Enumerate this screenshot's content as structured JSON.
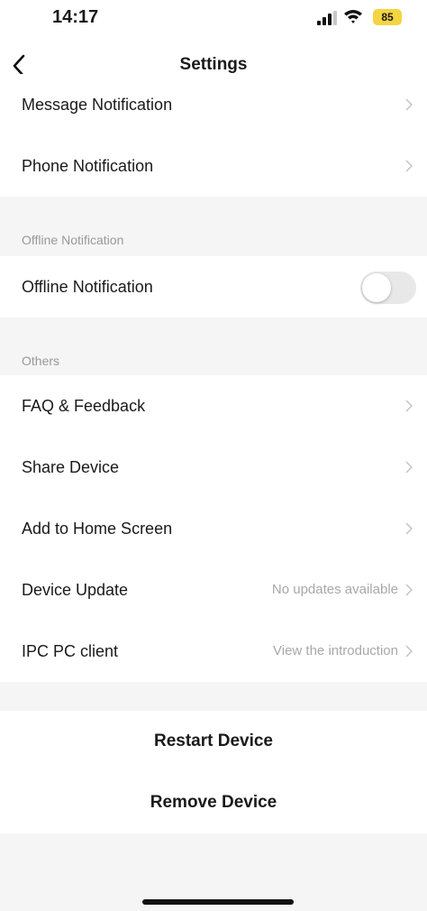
{
  "status_bar": {
    "time": "14:17",
    "battery": "85",
    "battery_color": "#f5d442"
  },
  "nav": {
    "title": "Settings",
    "back_icon": "chevron-left-icon"
  },
  "rows_top": [
    {
      "label": "Message Notification"
    },
    {
      "label": "Phone Notification"
    }
  ],
  "offline_section": {
    "header": "Offline Notification",
    "row_label": "Offline Notification",
    "toggle_on": false
  },
  "others_section": {
    "header": "Others",
    "rows": [
      {
        "label": "FAQ & Feedback",
        "value": ""
      },
      {
        "label": "Share Device",
        "value": ""
      },
      {
        "label": "Add to Home Screen",
        "value": ""
      },
      {
        "label": "Device Update",
        "value": "No updates available"
      },
      {
        "label": "IPC PC client",
        "value": "View the introduction"
      }
    ]
  },
  "actions": {
    "restart": "Restart Device",
    "remove": "Remove Device"
  }
}
